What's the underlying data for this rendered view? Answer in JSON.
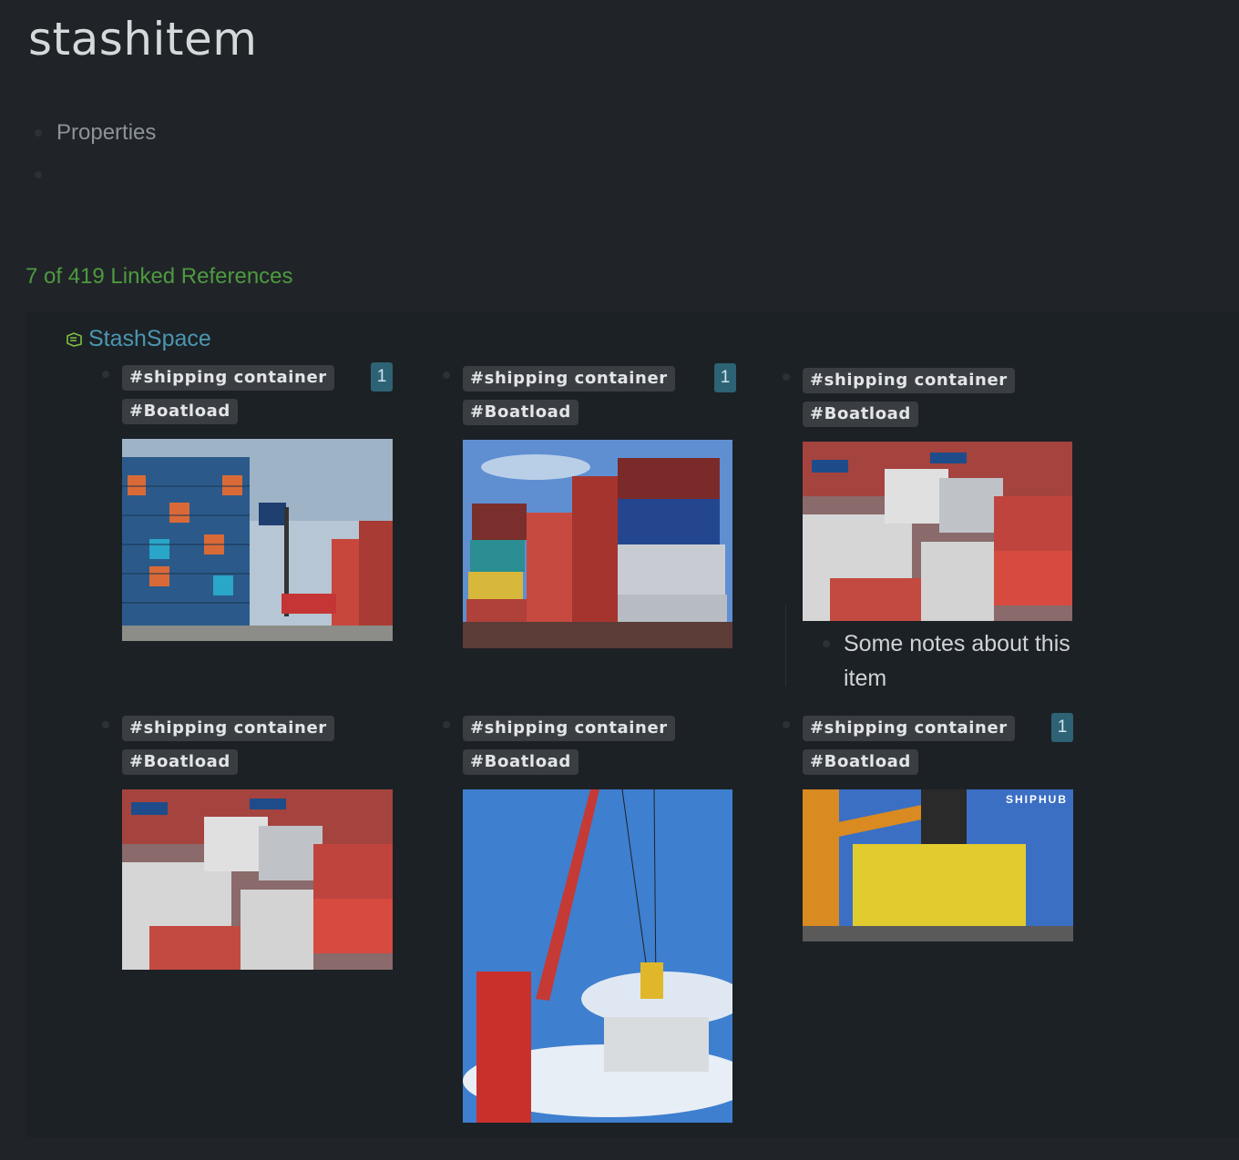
{
  "page": {
    "title": "stashitem"
  },
  "properties": {
    "label": "Properties",
    "empty_block": ""
  },
  "linked_references": {
    "heading": "7 of 419 Linked References"
  },
  "group": {
    "page_ref": "StashSpace",
    "cards": [
      {
        "tag1": "#shipping container",
        "tag2": "#Boatload",
        "badge": "1",
        "image": "container-stacks-forklift"
      },
      {
        "tag1": "#shipping container",
        "tag2": "#Boatload",
        "badge": "1",
        "image": "container-tower-sky"
      },
      {
        "tag1": "#shipping container",
        "tag2": "#Boatload",
        "badge": "",
        "image": "maersk-yard",
        "notes": "Some notes about this item"
      },
      {
        "tag1": "#shipping container",
        "tag2": "#Boatload",
        "badge": "",
        "image": "maersk-yard-2"
      },
      {
        "tag1": "#shipping container",
        "tag2": "#Boatload",
        "badge": "",
        "image": "crane-lift"
      },
      {
        "tag1": "#shipping container",
        "tag2": "#Boatload",
        "badge": "1",
        "image": "msc-container",
        "image_caption": "SHIPHUB"
      }
    ]
  },
  "colors": {
    "background": "#202428",
    "panel": "#1c2126",
    "link_green": "#4e9a3f",
    "link_blue": "#4b96b0",
    "tag_bg": "#3a3e43",
    "badge_bg": "#2d6374"
  }
}
